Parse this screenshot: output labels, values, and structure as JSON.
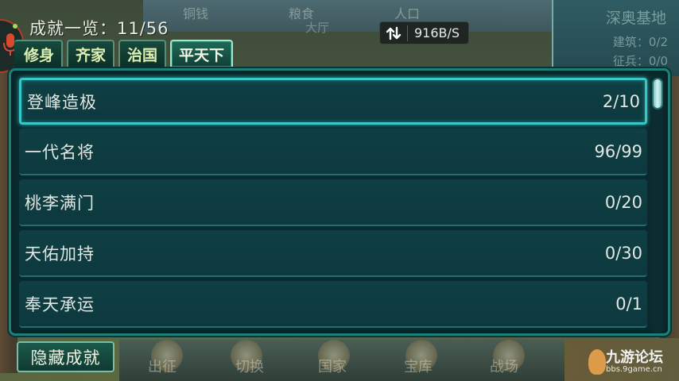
{
  "header": {
    "title": "成就一览：11/56"
  },
  "status_bar": {
    "network_icon": "transfer-arrows-icon",
    "network_rate": "916B/S"
  },
  "tabs": [
    {
      "label": "修身",
      "active": false
    },
    {
      "label": "齐家",
      "active": false
    },
    {
      "label": "治国",
      "active": false
    },
    {
      "label": "平天下",
      "active": true
    }
  ],
  "achievements": [
    {
      "name": "登峰造极",
      "progress": "2/10",
      "selected": true
    },
    {
      "name": "一代名将",
      "progress": "96/99",
      "selected": false
    },
    {
      "name": "桃李满门",
      "progress": "0/20",
      "selected": false
    },
    {
      "name": "天佑加持",
      "progress": "0/30",
      "selected": false
    },
    {
      "name": "奉天承运",
      "progress": "0/1",
      "selected": false
    }
  ],
  "footer": {
    "hide_button_label": "隐藏成就"
  },
  "background": {
    "top_items": [
      "铜钱",
      "粮食",
      "人口"
    ],
    "hall_label": "大厅",
    "region_panel": {
      "title": "深奥基地",
      "lines": [
        "建筑：0/2",
        "征兵：0/0"
      ]
    },
    "bottom_menu": [
      "出征",
      "切换",
      "国家",
      "宝库",
      "战场"
    ]
  },
  "watermark": {
    "title": "九游论坛",
    "url": "bbs.9game.cn"
  },
  "colors": {
    "panel_bg": "#0a2a2d",
    "panel_border": "#1c7f78",
    "selected_glow": "#38c7c7",
    "tab_text": "#dff0b2",
    "mic_accent": "#b23a26"
  }
}
